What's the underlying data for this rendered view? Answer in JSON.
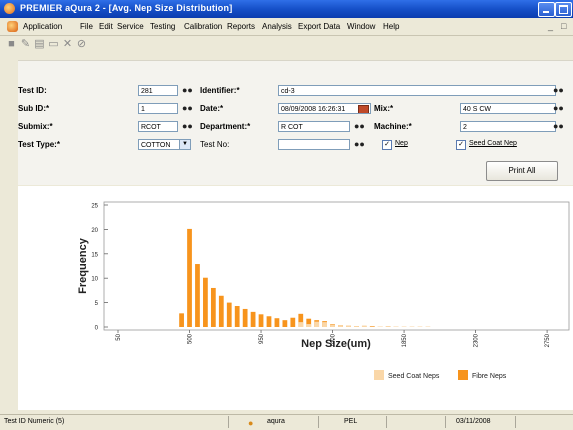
{
  "window": {
    "title": "PREMIER aQura 2 - [Avg. Nep Size Distribution]"
  },
  "menu": [
    "Application",
    "File",
    "Edit",
    "Service",
    "Testing",
    "Calibration",
    "Reports",
    "Analysis",
    "Export Data",
    "Window",
    "Help"
  ],
  "toolbar": [
    "save-icon",
    "edit-icon",
    "document-icon",
    "print-preview-icon",
    "delete-icon",
    "cancel-icon"
  ],
  "form": {
    "test_id_label": "Test ID:",
    "test_id": "281",
    "identifier_label": "Identifier:*",
    "identifier": "cd-3",
    "sub_id_label": "Sub ID:*",
    "sub_id": "1",
    "date_label": "Date:*",
    "date": "08/09/2008 16:26:31",
    "mix_label": "Mix:*",
    "mix": "40 S CW",
    "submix_label": "Submix:*",
    "submix": "RCOT",
    "department_label": "Department:*",
    "department": "R COT",
    "machine_label": "Machine:*",
    "machine": "2",
    "test_type_label": "Test Type:*",
    "test_type": "COTTON",
    "test_no_label": "Test No:",
    "test_no": "",
    "nep_label": "Nep",
    "nep_checked": true,
    "seed_coat_nep_label": "Seed Coat Nep",
    "seed_coat_checked": true,
    "print_all_label": "Print All"
  },
  "chart_data": {
    "type": "bar",
    "xlabel": "Nep Size(um)",
    "ylabel": "Frequency",
    "ylim": [
      0,
      25
    ],
    "yticks": [
      0,
      5,
      10,
      15,
      20,
      25
    ],
    "xlim": [
      50,
      2850
    ],
    "xticks": [
      "50",
      "500",
      "950",
      "1400",
      "1850",
      "2300",
      "2750"
    ],
    "bin_width": 50,
    "bin_start": 450,
    "series": [
      {
        "name": "Fibre Neps",
        "color": "#F7941D",
        "values": [
          2.8,
          20.1,
          12.9,
          10.1,
          8.0,
          6.4,
          5.0,
          4.3,
          3.7,
          3.1,
          2.6,
          2.2,
          1.8,
          1.4,
          1.9,
          2.7,
          1.7,
          1.4,
          1.2,
          0.6,
          0.4,
          0.3,
          0.2,
          0.1,
          0.2,
          0.1,
          0.1,
          0.1
        ]
      },
      {
        "name": "Seed Coat Neps",
        "color": "#FAD7A8",
        "values": [
          0,
          0,
          0,
          0,
          0,
          0,
          0,
          0,
          0,
          0,
          0,
          0,
          0,
          0,
          0,
          1.0,
          0.6,
          1.1,
          1.0,
          0.5,
          0.4,
          0.3,
          0.2,
          0.3,
          0.1,
          0.1,
          0.2,
          0.1,
          0.1,
          0.1,
          0.1,
          0.1,
          0,
          0,
          0,
          0,
          0,
          0,
          0,
          0,
          0,
          0,
          0,
          0,
          0,
          0,
          0,
          0,
          0,
          0,
          0.1
        ]
      }
    ],
    "legend": "bottom-right"
  },
  "status": {
    "left": "Test ID Numeric (5)",
    "user": "aqura",
    "site": "PEL",
    "date": "03/11/2008"
  }
}
